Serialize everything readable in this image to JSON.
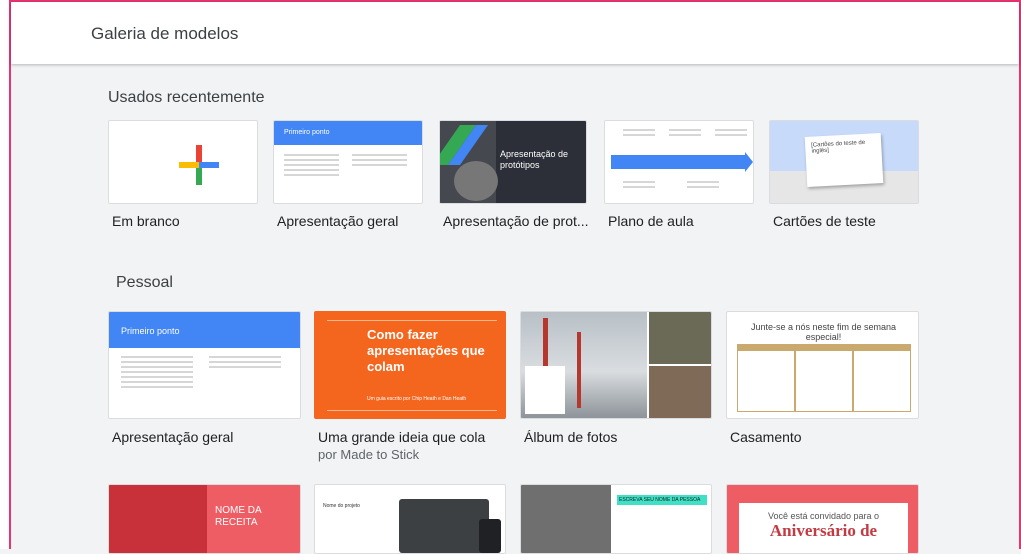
{
  "header": {
    "title": "Galeria de modelos"
  },
  "recent": {
    "title": "Usados recentemente",
    "items": [
      {
        "label": "Em branco"
      },
      {
        "label": "Apresentação geral",
        "thumb_heading": "Primeiro ponto"
      },
      {
        "label": "Apresentação de prot...",
        "thumb_heading": "Apresentação de protótipos"
      },
      {
        "label": "Plano de aula"
      },
      {
        "label": "Cartões de teste",
        "thumb_heading": "[Cartões do teste de inglês]"
      }
    ]
  },
  "personal": {
    "title": "Pessoal",
    "items": [
      {
        "label": "Apresentação geral",
        "thumb_heading": "Primeiro ponto"
      },
      {
        "label": "Uma grande ideia que cola",
        "sub": "por Made to Stick",
        "thumb_heading": "Como fazer apresentações que colam",
        "thumb_sub": "Um guia escrito por Chip Heath e Dan Heath"
      },
      {
        "label": "Álbum de fotos"
      },
      {
        "label": "Casamento",
        "thumb_heading": "Junte-se a nós neste fim de semana especial!"
      }
    ]
  },
  "bottom_row": [
    {
      "thumb_heading": "NOME DA RECEITA"
    },
    {
      "thumb_heading": "Nome do projeto"
    },
    {
      "thumb_heading": ""
    },
    {
      "thumb_heading": "ESCREVA SEU NOME DA PESSOA"
    },
    {
      "thumb_heading": "Você está convidado para o",
      "thumb_big": "Aniversário de"
    }
  ]
}
